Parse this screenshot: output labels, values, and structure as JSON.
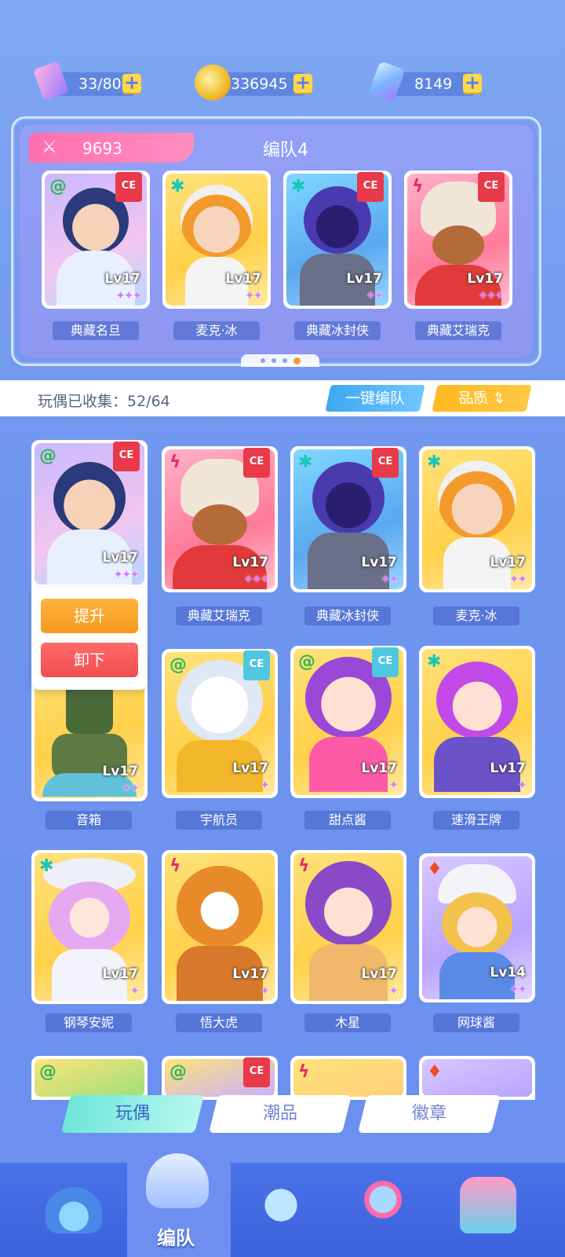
{
  "resources": {
    "tickets": "33/80",
    "coins": "336945",
    "gems": "8149",
    "plus": "+"
  },
  "team": {
    "power": "9693",
    "title": "编队4",
    "members": [
      {
        "name": "典藏名旦",
        "level": "Lv17",
        "stars": "✦✦✦",
        "element": "@"
      },
      {
        "name": "麦克·冰",
        "level": "Lv17",
        "stars": "✦✦",
        "element": "✱"
      },
      {
        "name": "典藏冰封侠",
        "level": "Lv17",
        "stars": "✦✦",
        "element": "✱"
      },
      {
        "name": "典藏艾瑞克",
        "level": "Lv17",
        "stars": "✦✦✦",
        "element": "ϟ"
      }
    ],
    "ce_badge": "CE"
  },
  "collection": {
    "label": "玩偶已收集：52/64",
    "one_key_button": "一键编队",
    "quality_button": "品质"
  },
  "popup": {
    "upgrade": "提升",
    "unequip": "卸下"
  },
  "dolls": [
    {
      "name": "",
      "level": "Lv17",
      "stars": "✦✦✦",
      "element": "@"
    },
    {
      "name": "典藏艾瑞克",
      "level": "Lv17",
      "stars": "✦✦✦",
      "element": "ϟ"
    },
    {
      "name": "典藏冰封侠",
      "level": "Lv17",
      "stars": "✦✦",
      "element": "✱"
    },
    {
      "name": "麦克·冰",
      "level": "Lv17",
      "stars": "✦✦",
      "element": "✱"
    },
    {
      "name": "音箱",
      "level": "Lv17",
      "stars": "✦✦",
      "element": ""
    },
    {
      "name": "宇航员",
      "level": "Lv17",
      "stars": "✦",
      "element": "@"
    },
    {
      "name": "甜点酱",
      "level": "Lv17",
      "stars": "✦",
      "element": "@"
    },
    {
      "name": "速滑王牌",
      "level": "Lv17",
      "stars": "✦",
      "element": "✱"
    },
    {
      "name": "钢琴安妮",
      "level": "Lv17",
      "stars": "✦",
      "element": "✱"
    },
    {
      "name": "悟大虎",
      "level": "Lv17",
      "stars": "✦",
      "element": "ϟ"
    },
    {
      "name": "木星",
      "level": "Lv17",
      "stars": "✦",
      "element": "ϟ"
    },
    {
      "name": "网球酱",
      "level": "Lv14",
      "stars": "✦✦",
      "element": "♦"
    }
  ],
  "tabs": [
    "玩偶",
    "潮品",
    "徽章"
  ],
  "nav": {
    "active_label": "编队"
  },
  "colors": {
    "background": "#6f96ee",
    "accent_pink": "#ff6fae",
    "accent_orange": "#f59a20",
    "accent_red": "#f04e4e",
    "tab_active": "#6ee6d8"
  }
}
